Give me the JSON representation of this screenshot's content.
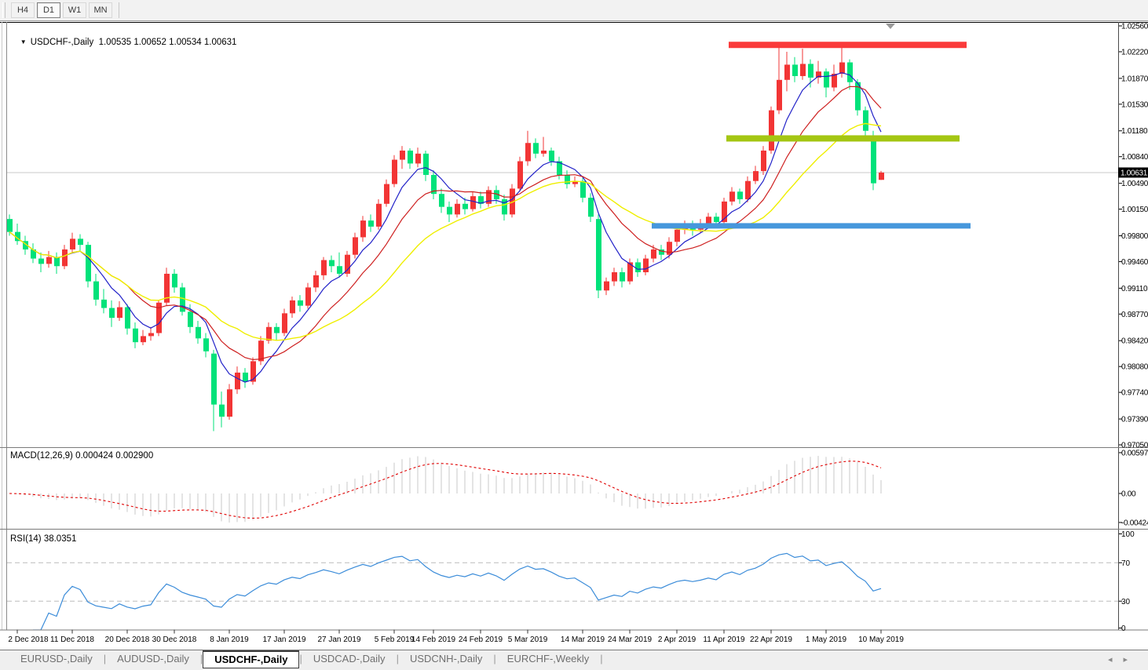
{
  "toolbar": {
    "buttons": [
      {
        "label": "H4",
        "active": false
      },
      {
        "label": "D1",
        "active": true
      },
      {
        "label": "W1",
        "active": false
      },
      {
        "label": "MN",
        "active": false
      }
    ]
  },
  "title": {
    "triangle": "▼",
    "symbol": "USDCHF-,Daily",
    "ohlc": "1.00535 1.00652 1.00534 1.00631"
  },
  "indicators": {
    "macd": {
      "display": "MACD(12,26,9) 0.000424 0.002900",
      "params": [
        12,
        26,
        9
      ],
      "value_main": 0.000424,
      "value_signal": 0.0029,
      "axis_labels": [
        {
          "v": 0.00597,
          "label": "0.00597"
        },
        {
          "v": 0,
          "label": "0.00"
        },
        {
          "v": -0.00424,
          "label": "-0.00424"
        }
      ]
    },
    "rsi": {
      "display": "RSI(14) 38.0351",
      "period": 14,
      "value": 38.0351,
      "levels": [
        70,
        30
      ],
      "axis_labels": [
        {
          "v": 100,
          "label": "100"
        },
        {
          "v": 70,
          "label": "70"
        },
        {
          "v": 30,
          "label": "30"
        },
        {
          "v": 0,
          "label": "0"
        }
      ]
    }
  },
  "price_axis": {
    "labels": [
      "1.02560",
      "1.02220",
      "1.01870",
      "1.01530",
      "1.01180",
      "1.00840",
      "1.00490",
      "1.00150",
      "0.99800",
      "0.99460",
      "0.99110",
      "0.98770",
      "0.98420",
      "0.98080",
      "0.97740",
      "0.97390",
      "0.97050"
    ],
    "current_label": "1.00631",
    "max": 1.0256,
    "min": 0.9705
  },
  "colors": {
    "candle_up": "#F23535",
    "candle_down": "#00E27A",
    "ma_fast": "#2121C8",
    "ma_mid": "#CE2020",
    "ma_slow": "#EFEF00",
    "band_red": "#FA3B3B",
    "band_olive": "#A4C613",
    "band_blue": "#4697DC",
    "current_line": "#C8C8C8",
    "macd_hist": "#C9C9C9",
    "macd_signal": "#E00000",
    "rsi_line": "#3B8CD9",
    "rsi_levels": "#BBBBBB",
    "axis_text": "#000000",
    "separator": "#7a7a7a"
  },
  "chart_data": {
    "type": "candlestick",
    "symbol": "USDCHF-",
    "timeframe": "Daily",
    "current_ohlc": {
      "open": 1.00535,
      "high": 1.00652,
      "low": 1.00534,
      "close": 1.00631
    },
    "y_range": {
      "max": 1.0256,
      "min": 0.9705
    },
    "ma_overlays": [
      {
        "name": "ma-fast-blue",
        "period": 8
      },
      {
        "name": "ma-mid-red",
        "period": 16
      },
      {
        "name": "ma-slow-yellow",
        "period": 30
      }
    ],
    "bands": [
      {
        "name": "resistance-red",
        "price": 1.0231,
        "from_bar": 91.6,
        "to_bar": 121.9,
        "thickness": 8,
        "color_key": "band_red"
      },
      {
        "name": "support-olive",
        "price": 1.0108,
        "from_bar": 91.3,
        "to_bar": 121.0,
        "thickness": 8,
        "color_key": "band_olive"
      },
      {
        "name": "support-blue",
        "price": 0.9993,
        "from_bar": 81.8,
        "to_bar": 122.4,
        "thickness": 7,
        "color_key": "band_blue"
      }
    ],
    "current_price_line": 1.00631,
    "date_axis": [
      {
        "label": "2 Dec 2018",
        "bar": 1
      },
      {
        "label": "11 Dec 2018",
        "bar": 8
      },
      {
        "label": "20 Dec 2018",
        "bar": 15
      },
      {
        "label": "30 Dec 2018",
        "bar": 21
      },
      {
        "label": "8 Jan 2019",
        "bar": 28
      },
      {
        "label": "17 Jan 2019",
        "bar": 35
      },
      {
        "label": "27 Jan 2019",
        "bar": 42
      },
      {
        "label": "5 Feb 2019",
        "bar": 49
      },
      {
        "label": "14 Feb 2019",
        "bar": 54
      },
      {
        "label": "24 Feb 2019",
        "bar": 60
      },
      {
        "label": "5 Mar 2019",
        "bar": 66
      },
      {
        "label": "14 Mar 2019",
        "bar": 73
      },
      {
        "label": "24 Mar 2019",
        "bar": 79
      },
      {
        "label": "2 Apr 2019",
        "bar": 85
      },
      {
        "label": "11 Apr 2019",
        "bar": 91
      },
      {
        "label": "22 Apr 2019",
        "bar": 97
      },
      {
        "label": "1 May 2019",
        "bar": 104
      },
      {
        "label": "10 May 2019",
        "bar": 111
      }
    ],
    "candles": [
      [
        1.0002,
        1.0008,
        0.998,
        0.9985
      ],
      [
        0.9985,
        0.9996,
        0.9968,
        0.9973
      ],
      [
        0.9973,
        0.998,
        0.9955,
        0.9962
      ],
      [
        0.9962,
        0.997,
        0.9944,
        0.995
      ],
      [
        0.995,
        0.9958,
        0.9932,
        0.9943
      ],
      [
        0.9943,
        0.996,
        0.9938,
        0.9952
      ],
      [
        0.9952,
        0.9958,
        0.993,
        0.994
      ],
      [
        0.994,
        0.9968,
        0.9936,
        0.9962
      ],
      [
        0.9962,
        0.9984,
        0.9958,
        0.9976
      ],
      [
        0.9976,
        0.9982,
        0.996,
        0.9968
      ],
      [
        0.9968,
        0.9972,
        0.9912,
        0.992
      ],
      [
        0.992,
        0.993,
        0.9888,
        0.9896
      ],
      [
        0.9896,
        0.991,
        0.9878,
        0.9885
      ],
      [
        0.9885,
        0.9895,
        0.986,
        0.9872
      ],
      [
        0.9872,
        0.9894,
        0.9868,
        0.9886
      ],
      [
        0.9886,
        0.989,
        0.985,
        0.9858
      ],
      [
        0.9858,
        0.9866,
        0.9832,
        0.984
      ],
      [
        0.984,
        0.9856,
        0.9836,
        0.9848
      ],
      [
        0.9848,
        0.986,
        0.9842,
        0.9852
      ],
      [
        0.9852,
        0.9895,
        0.9848,
        0.9892
      ],
      [
        0.9892,
        0.9938,
        0.9888,
        0.993
      ],
      [
        0.993,
        0.9936,
        0.9905,
        0.9912
      ],
      [
        0.9912,
        0.9918,
        0.9875,
        0.988
      ],
      [
        0.988,
        0.989,
        0.9852,
        0.986
      ],
      [
        0.986,
        0.9868,
        0.9838,
        0.9845
      ],
      [
        0.9845,
        0.9852,
        0.982,
        0.9828
      ],
      [
        0.9825,
        0.983,
        0.9723,
        0.9758
      ],
      [
        0.9758,
        0.9775,
        0.9728,
        0.9742
      ],
      [
        0.9742,
        0.9785,
        0.9738,
        0.9778
      ],
      [
        0.9778,
        0.9808,
        0.9772,
        0.98
      ],
      [
        0.98,
        0.9806,
        0.978,
        0.9788
      ],
      [
        0.9788,
        0.982,
        0.9784,
        0.9815
      ],
      [
        0.9815,
        0.9848,
        0.981,
        0.9842
      ],
      [
        0.9842,
        0.9866,
        0.9838,
        0.986
      ],
      [
        0.986,
        0.9865,
        0.9842,
        0.9852
      ],
      [
        0.9852,
        0.9884,
        0.9848,
        0.9878
      ],
      [
        0.9878,
        0.99,
        0.9872,
        0.9895
      ],
      [
        0.9895,
        0.9902,
        0.988,
        0.9888
      ],
      [
        0.9888,
        0.9918,
        0.9884,
        0.9912
      ],
      [
        0.9912,
        0.9934,
        0.9906,
        0.9928
      ],
      [
        0.9928,
        0.9952,
        0.9922,
        0.9948
      ],
      [
        0.9948,
        0.9954,
        0.9932,
        0.994
      ],
      [
        0.994,
        0.9958,
        0.9925,
        0.993
      ],
      [
        0.993,
        0.996,
        0.9926,
        0.9955
      ],
      [
        0.9955,
        0.9984,
        0.995,
        0.9978
      ],
      [
        0.9978,
        1.0006,
        0.9972,
        1.0
      ],
      [
        1.0,
        1.0008,
        0.9985,
        0.9992
      ],
      [
        0.9992,
        1.0028,
        0.9988,
        1.0022
      ],
      [
        1.0022,
        1.0054,
        1.0018,
        1.0048
      ],
      [
        1.0048,
        1.0086,
        1.0044,
        1.008
      ],
      [
        1.008,
        1.0098,
        1.0068,
        1.0092
      ],
      [
        1.0092,
        1.0095,
        1.0068,
        1.0075
      ],
      [
        1.0075,
        1.0096,
        1.007,
        1.0088
      ],
      [
        1.0088,
        1.0092,
        1.0052,
        1.006
      ],
      [
        1.006,
        1.0066,
        1.0028,
        1.0035
      ],
      [
        1.0035,
        1.0042,
        1.001,
        1.0018
      ],
      [
        1.0018,
        1.0025,
        0.9998,
        1.0008
      ],
      [
        1.0008,
        1.0028,
        1.0004,
        1.0022
      ],
      [
        1.0022,
        1.003,
        1.0008,
        1.0015
      ],
      [
        1.0015,
        1.0038,
        1.0012,
        1.0032
      ],
      [
        1.0032,
        1.0038,
        1.0016,
        1.0022
      ],
      [
        1.0022,
        1.0045,
        1.0018,
        1.004
      ],
      [
        1.004,
        1.0046,
        1.0022,
        1.0028
      ],
      [
        1.0028,
        1.0034,
        1.0,
        1.0008
      ],
      [
        1.0008,
        1.0048,
        1.0004,
        1.0042
      ],
      [
        1.0042,
        1.0084,
        1.0038,
        1.0078
      ],
      [
        1.0078,
        1.0118,
        1.0072,
        1.0102
      ],
      [
        1.0102,
        1.0108,
        1.0082,
        1.0088
      ],
      [
        1.0088,
        1.011,
        1.0084,
        1.0092
      ],
      [
        1.0092,
        1.0096,
        1.0072,
        1.0078
      ],
      [
        1.0078,
        1.0084,
        1.0054,
        1.006
      ],
      [
        1.006,
        1.0066,
        1.0042,
        1.0048
      ],
      [
        1.0048,
        1.0058,
        1.0044,
        1.0052
      ],
      [
        1.0052,
        1.0056,
        1.0024,
        1.003
      ],
      [
        1.003,
        1.0036,
        0.9998,
        1.0005
      ],
      [
        1.0002,
        1.0008,
        0.9898,
        0.9908
      ],
      [
        0.9908,
        0.9925,
        0.9902,
        0.992
      ],
      [
        0.992,
        0.9938,
        0.9914,
        0.9932
      ],
      [
        0.9932,
        0.9938,
        0.9912,
        0.992
      ],
      [
        0.992,
        0.995,
        0.9916,
        0.9945
      ],
      [
        0.9945,
        0.995,
        0.9926,
        0.9932
      ],
      [
        0.9932,
        0.9955,
        0.9928,
        0.995
      ],
      [
        0.995,
        0.9968,
        0.9945,
        0.9962
      ],
      [
        0.9962,
        0.9968,
        0.9948,
        0.9955
      ],
      [
        0.9955,
        0.9978,
        0.995,
        0.9972
      ],
      [
        0.9972,
        0.9992,
        0.9966,
        0.9988
      ],
      [
        0.9988,
        1.0,
        0.9982,
        0.9995
      ],
      [
        0.9995,
        1.0,
        0.998,
        0.9988
      ],
      [
        0.9988,
        1.0002,
        0.9984,
        0.9995
      ],
      [
        0.9995,
        1.001,
        0.999,
        1.0005
      ],
      [
        1.0005,
        1.001,
        0.9992,
        0.9998
      ],
      [
        0.9998,
        1.003,
        0.9994,
        1.0025
      ],
      [
        1.0025,
        1.0044,
        1.002,
        1.0038
      ],
      [
        1.0038,
        1.0042,
        1.0022,
        1.0028
      ],
      [
        1.0028,
        1.0058,
        1.0024,
        1.0052
      ],
      [
        1.0052,
        1.0072,
        1.0048,
        1.0065
      ],
      [
        1.0065,
        1.0098,
        1.006,
        1.0092
      ],
      [
        1.0092,
        1.015,
        1.0088,
        1.0145
      ],
      [
        1.0145,
        1.0228,
        1.014,
        1.0185
      ],
      [
        1.0185,
        1.0222,
        1.017,
        1.0205
      ],
      [
        1.0205,
        1.0215,
        1.0182,
        1.019
      ],
      [
        1.019,
        1.0226,
        1.0185,
        1.0206
      ],
      [
        1.0206,
        1.0212,
        1.0175,
        1.0188
      ],
      [
        1.0188,
        1.021,
        1.018,
        1.0196
      ],
      [
        1.0196,
        1.02,
        1.0162,
        1.0175
      ],
      [
        1.0175,
        1.0205,
        1.017,
        1.0193
      ],
      [
        1.0193,
        1.0228,
        1.0188,
        1.0208
      ],
      [
        1.0208,
        1.0212,
        1.0172,
        1.0182
      ],
      [
        1.0182,
        1.0186,
        1.0138,
        1.0145
      ],
      [
        1.0145,
        1.015,
        1.0106,
        1.0118
      ],
      [
        1.0112,
        1.0118,
        1.004,
        1.0049
      ],
      [
        1.00535,
        1.00652,
        1.00534,
        1.00631
      ]
    ]
  },
  "tabs": {
    "items": [
      {
        "label": "EURUSD-,Daily",
        "active": false
      },
      {
        "label": "AUDUSD-,Daily",
        "active": false
      },
      {
        "label": "USDCHF-,Daily",
        "active": true
      },
      {
        "label": "USDCAD-,Daily",
        "active": false
      },
      {
        "label": "USDCNH-,Daily",
        "active": false
      },
      {
        "label": "EURCHF-,Weekly",
        "active": false
      }
    ],
    "scroll_left": "◂",
    "scroll_right": "▸"
  }
}
